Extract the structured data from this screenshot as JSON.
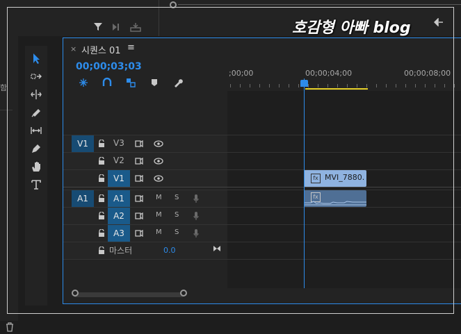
{
  "watermark": "호감형 아빠 blog",
  "left_panel": {
    "side_char": "함"
  },
  "sequence": {
    "tab_close": "×",
    "title": "시퀀스 01",
    "menu_icon": "≡",
    "timecode": "00;00;03;03"
  },
  "ruler": {
    "labels": [
      ";00;00",
      "00;00;04;00",
      "00;00;08;00"
    ]
  },
  "tracks": {
    "video": [
      {
        "source": "V1",
        "name": "V3",
        "lock": "lock-icon",
        "show_source": true
      },
      {
        "source": "",
        "name": "V2",
        "lock": "lock-icon",
        "show_source": false
      },
      {
        "source": "",
        "name": "V1",
        "lock": "lock-icon",
        "show_source": false
      }
    ],
    "audio": [
      {
        "source": "A1",
        "name": "A1",
        "m": "M",
        "s": "S"
      },
      {
        "source": "",
        "name": "A2",
        "m": "M",
        "s": "S"
      },
      {
        "source": "",
        "name": "A3",
        "m": "M",
        "s": "S"
      }
    ],
    "master_label": "마스터",
    "master_value": "0.0"
  },
  "clips": {
    "video_clip_name": "MVI_7880.",
    "fx_label": "fx"
  },
  "colors": {
    "accent": "#2d8ceb",
    "inout": "#e8d22a",
    "clip_video": "#8fb3e0",
    "clip_audio": "#4f6f95"
  }
}
